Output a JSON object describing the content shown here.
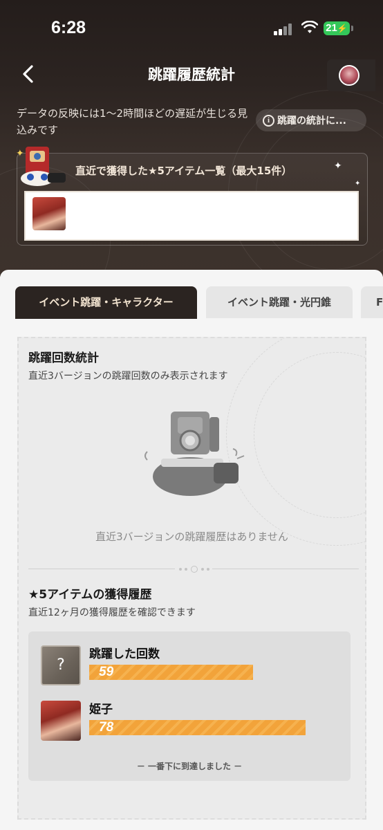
{
  "status_bar": {
    "time": "6:28",
    "battery": "21"
  },
  "nav": {
    "title": "跳躍履歴統計"
  },
  "notice": {
    "text": "データの反映には1〜2時間ほどの遅延が生じる見込みです",
    "info_button": "跳躍の統計に..."
  },
  "recent": {
    "title": "直近で獲得した★5アイテム一覧（最大15件）"
  },
  "tabs": [
    {
      "label": "イベント跳躍・キャラクター"
    },
    {
      "label": "イベント跳躍・光円錐"
    },
    {
      "label": "F"
    }
  ],
  "stats": {
    "title": "跳躍回数統計",
    "subtitle": "直近3バージョンの跳躍回数のみ表示されます",
    "empty": "直近3バージョンの跳躍履歴はありません"
  },
  "history": {
    "title": "★5アイテムの獲得履歴",
    "subtitle": "直近12ヶ月の獲得履歴を確認できます",
    "items": [
      {
        "name": "跳躍した回数",
        "count": "59",
        "icon": "unknown-icon",
        "icon_glyph": "?",
        "fraction": 0.65
      },
      {
        "name": "姫子",
        "count": "78",
        "icon": "himeko-portrait",
        "fraction": 0.86
      }
    ],
    "end_note": "－ 一番下に到達しました －"
  },
  "colors": {
    "accent_orange": "#f2a33a",
    "dark": "#2b2421",
    "battery": "#34c759"
  }
}
